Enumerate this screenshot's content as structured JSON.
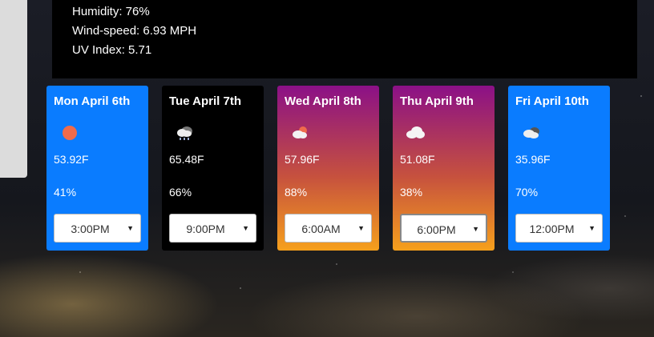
{
  "current": {
    "humidity": "Humidity: 76%",
    "wind": "Wind-speed: 6.93 MPH",
    "uv": "UV Index: 5.71"
  },
  "forecast": [
    {
      "day": "Mon April 6th",
      "icon": "sun-icon",
      "temp": "53.92F",
      "humidity": "41%",
      "time": "3:00PM",
      "style": "blue"
    },
    {
      "day": "Tue April 7th",
      "icon": "rain-cloud-icon",
      "temp": "65.48F",
      "humidity": "66%",
      "time": "9:00PM",
      "style": "black"
    },
    {
      "day": "Wed April 8th",
      "icon": "partly-cloudy-icon",
      "temp": "57.96F",
      "humidity": "88%",
      "time": "6:00AM",
      "style": "sunset"
    },
    {
      "day": "Thu April 9th",
      "icon": "cloud-icon",
      "temp": "51.08F",
      "humidity": "38%",
      "time": "6:00PM",
      "style": "sunset"
    },
    {
      "day": "Fri April 10th",
      "icon": "dark-cloud-icon",
      "temp": "35.96F",
      "humidity": "70%",
      "time": "12:00PM",
      "style": "blue"
    }
  ],
  "colors": {
    "blue_card": "#0a7cff",
    "sun": "#ef6b4c",
    "sunset_top": "#8b1087",
    "sunset_bottom": "#f6a01c"
  }
}
